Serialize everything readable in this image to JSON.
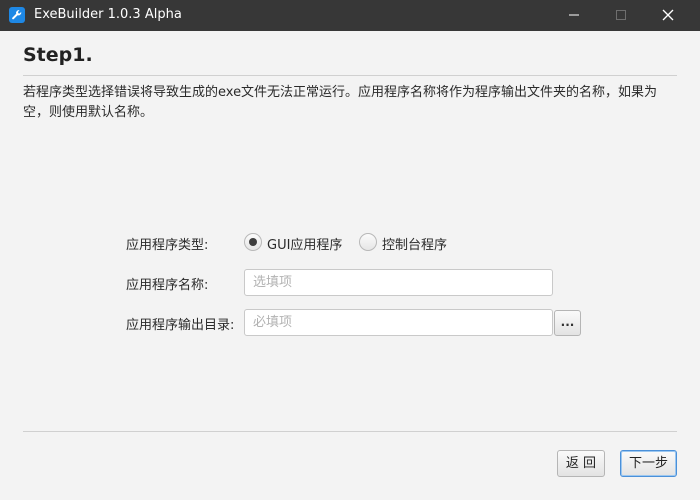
{
  "window": {
    "title": "ExeBuilder 1.0.3 Alpha",
    "icon": "app-wrench-icon",
    "controls": [
      "minimize-icon",
      "maximize-icon",
      "close-icon"
    ]
  },
  "header": {
    "title": "Step1.",
    "description": "若程序类型选择错误将导致生成的exe文件无法正常运行。应用程序名称将作为程序输出文件夹的名称，如果为空，则使用默认名称。"
  },
  "form": {
    "type_label": "应用程序类型:",
    "type_options": [
      {
        "label": "GUI应用程序",
        "selected": true
      },
      {
        "label": "控制台程序",
        "selected": false
      }
    ],
    "name_label": "应用程序名称:",
    "name_value": "",
    "name_placeholder": "选填项",
    "dir_label": "应用程序输出目录:",
    "dir_value": "",
    "dir_placeholder": "必填项",
    "browse_label": "..."
  },
  "footer": {
    "back_label": "返 回",
    "next_label": "下一步"
  },
  "colors": {
    "titlebar": "#373737",
    "content_bg": "#f3f3f3",
    "accent_focus": "#4a90d9"
  }
}
